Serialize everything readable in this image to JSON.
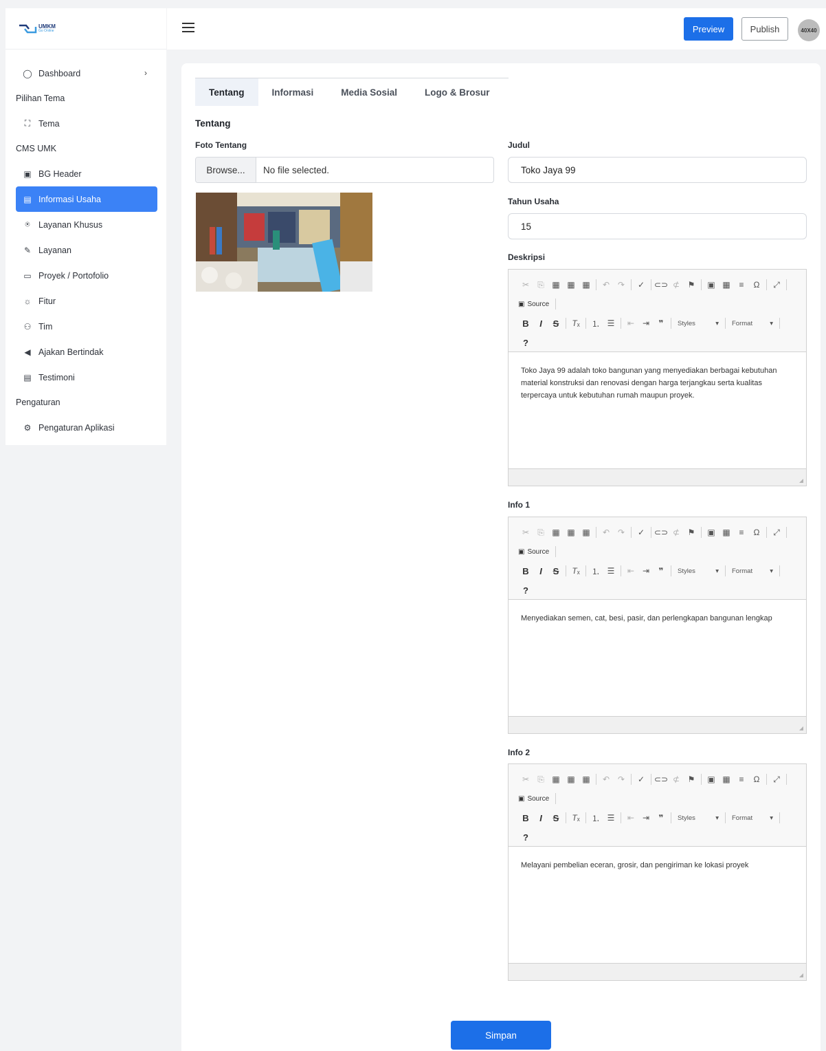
{
  "brand": {
    "logo_text": "UMKM",
    "logo_sub": "Go Online"
  },
  "sidebar": {
    "items": [
      {
        "type": "item",
        "label": "Dashboard",
        "icon": "circle-icon",
        "chevron": true
      },
      {
        "type": "section",
        "label": "Pilihan Tema"
      },
      {
        "type": "item",
        "label": "Tema",
        "icon": "palette-icon"
      },
      {
        "type": "section",
        "label": "CMS UMK"
      },
      {
        "type": "item",
        "label": "BG Header",
        "icon": "image-icon"
      },
      {
        "type": "item",
        "label": "Informasi Usaha",
        "icon": "info-card-icon",
        "active": true
      },
      {
        "type": "item",
        "label": "Layanan Khusus",
        "icon": "star-circle-icon"
      },
      {
        "type": "item",
        "label": "Layanan",
        "icon": "handshake-icon"
      },
      {
        "type": "item",
        "label": "Proyek / Portofolio",
        "icon": "briefcase-icon"
      },
      {
        "type": "item",
        "label": "Fitur",
        "icon": "bulb-icon"
      },
      {
        "type": "item",
        "label": "Tim",
        "icon": "team-icon"
      },
      {
        "type": "item",
        "label": "Ajakan Bertindak",
        "icon": "megaphone-icon"
      },
      {
        "type": "item",
        "label": "Testimoni",
        "icon": "message-icon"
      },
      {
        "type": "section",
        "label": "Pengaturan"
      },
      {
        "type": "item",
        "label": "Pengaturan Aplikasi",
        "icon": "gear-icon"
      }
    ]
  },
  "header": {
    "preview_label": "Preview",
    "publish_label": "Publish",
    "avatar_text": "40X40",
    "accent": "#1c6fe8"
  },
  "tabs": [
    "Tentang",
    "Informasi",
    "Media Sosial",
    "Logo & Brosur"
  ],
  "form": {
    "section_title": "Tentang",
    "photo_label": "Foto Tentang",
    "browse_label": "Browse...",
    "file_status": "No file selected.",
    "judul_label": "Judul",
    "judul_value": "Toko Jaya 99",
    "tahun_label": "Tahun Usaha",
    "tahun_value": "15",
    "deskripsi_label": "Deskripsi",
    "deskripsi_value": "Toko Jaya 99 adalah toko bangunan yang menyediakan berbagai kebutuhan material konstruksi dan renovasi dengan harga terjangkau serta kualitas terpercaya untuk kebutuhan rumah maupun proyek.",
    "info1_label": "Info 1",
    "info1_value": "Menyediakan semen, cat, besi, pasir, dan perlengkapan bangunan lengkap",
    "info2_label": "Info 2",
    "info2_value": "Melayani pembelian eceran, grosir, dan pengiriman ke lokasi proyek",
    "save_label": "Simpan"
  },
  "editor_toolbar": {
    "source_label": "Source",
    "styles_label": "Styles",
    "format_label": "Format",
    "help_label": "?"
  }
}
